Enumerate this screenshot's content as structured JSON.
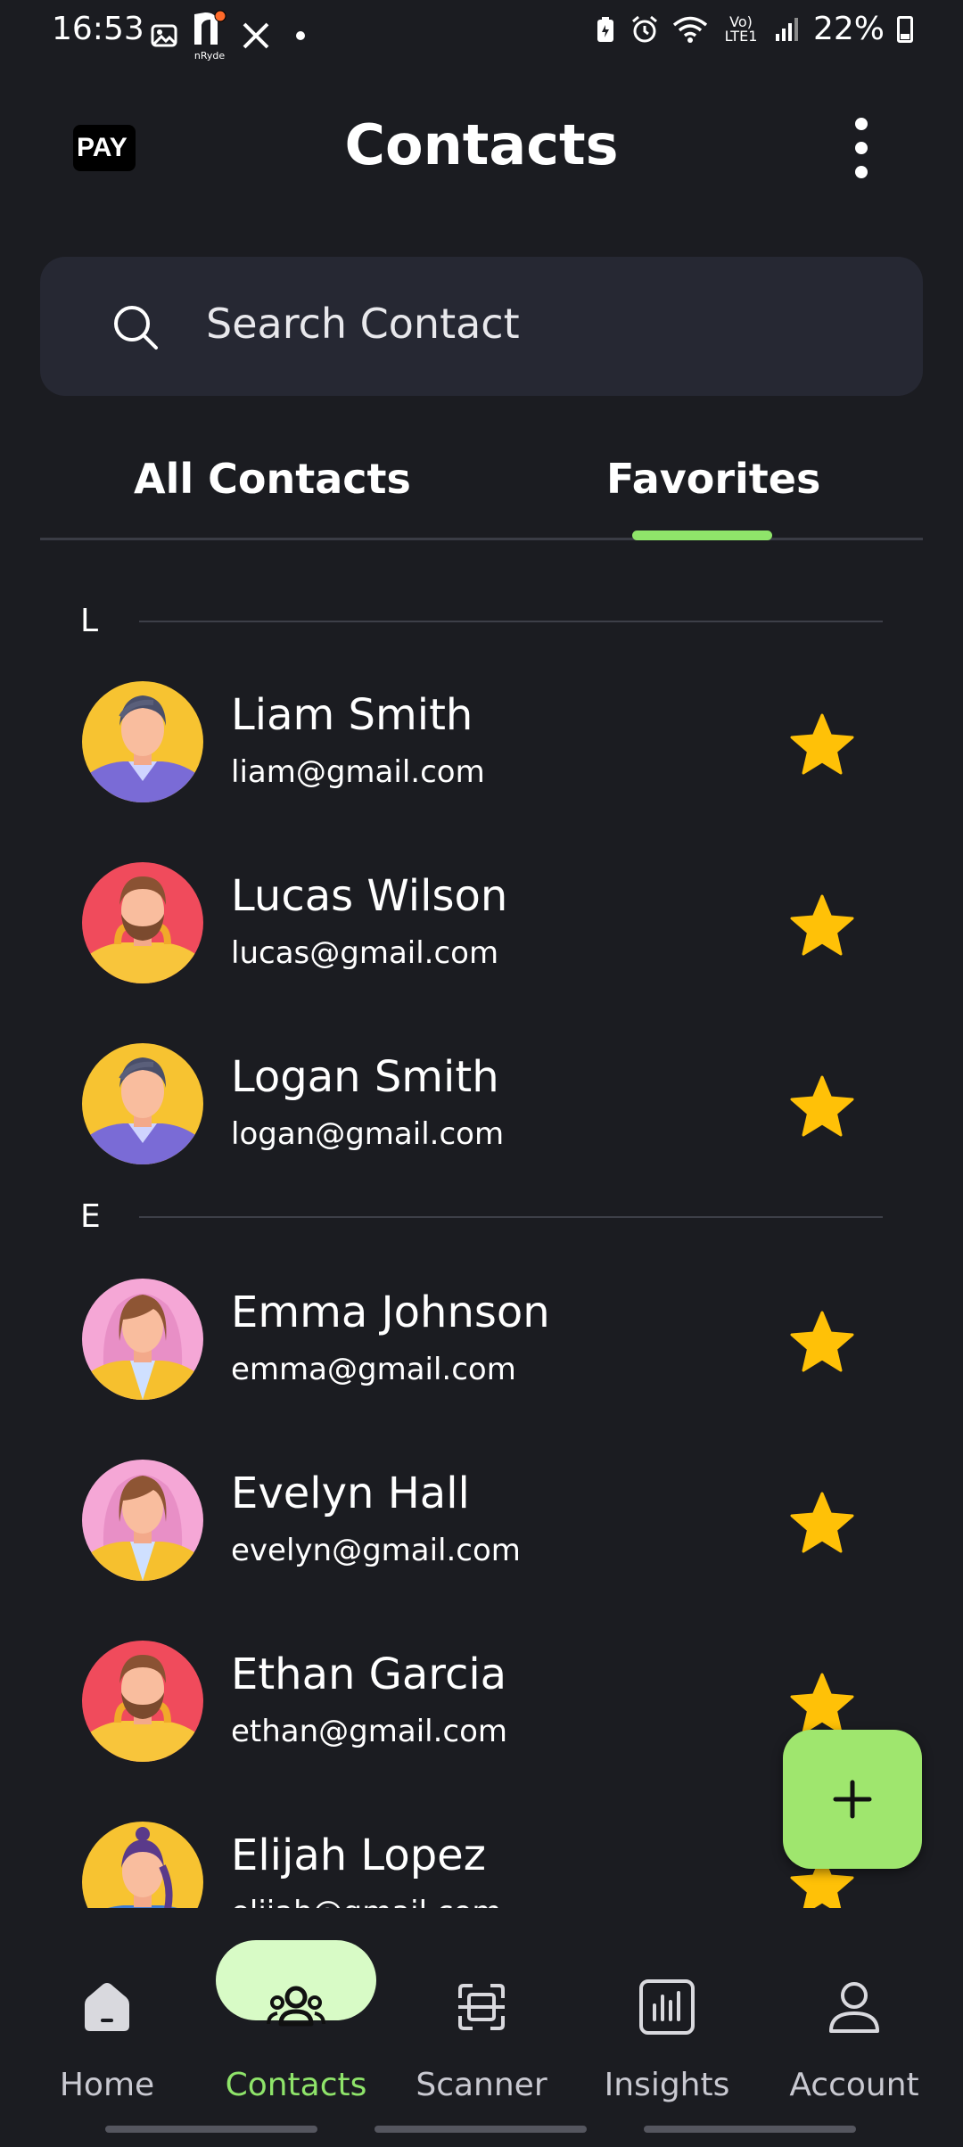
{
  "status_bar": {
    "time": "16:53",
    "battery": "22%",
    "network": "Vo) LTE1",
    "icons": [
      "gallery-icon",
      "nryde-icon",
      "x-icon",
      "dot-icon",
      "battery-saver-icon",
      "alarm-icon",
      "wifi-icon",
      "signal-icon",
      "battery-icon"
    ],
    "nryde_label": "nRyde"
  },
  "header": {
    "logo_text": "PAY",
    "title": "Contacts",
    "menu_icon": "more-vertical-icon"
  },
  "search": {
    "placeholder": "Search Contact",
    "icon": "search-icon"
  },
  "tabs": [
    {
      "label": "All Contacts",
      "active": false
    },
    {
      "label": "Favorites",
      "active": true
    }
  ],
  "colors": {
    "background": "#1b1c21",
    "surface": "#262833",
    "accent": "#8fe46a",
    "fab": "#9fe66e",
    "star": "#ffc107"
  },
  "sections": [
    {
      "letter": "L",
      "contacts": [
        {
          "name": "Liam Smith",
          "email": "liam@gmail.com",
          "favorite": true,
          "avatar": "male-avatar-icon"
        },
        {
          "name": "Lucas Wilson",
          "email": "lucas@gmail.com",
          "favorite": true,
          "avatar": "bearded-male-avatar-icon"
        },
        {
          "name": "Logan Smith",
          "email": "logan@gmail.com",
          "favorite": true,
          "avatar": "male-avatar-icon"
        }
      ]
    },
    {
      "letter": "E",
      "contacts": [
        {
          "name": "Emma Johnson",
          "email": "emma@gmail.com",
          "favorite": true,
          "avatar": "female-avatar-icon"
        },
        {
          "name": "Evelyn Hall",
          "email": "evelyn@gmail.com",
          "favorite": true,
          "avatar": "female-avatar-icon"
        },
        {
          "name": "Ethan Garcia",
          "email": "ethan@gmail.com",
          "favorite": true,
          "avatar": "bearded-male-avatar-icon"
        },
        {
          "name": "Elijah Lopez",
          "email": "elijah@gmail.com",
          "favorite": true,
          "avatar": "ponytail-avatar-icon"
        }
      ]
    }
  ],
  "fab": {
    "icon": "plus-icon"
  },
  "bottom_nav": [
    {
      "label": "Home",
      "icon": "home-icon",
      "active": false
    },
    {
      "label": "Contacts",
      "icon": "contacts-group-icon",
      "active": true
    },
    {
      "label": "Scanner",
      "icon": "scanner-icon",
      "active": false
    },
    {
      "label": "Insights",
      "icon": "insights-chart-icon",
      "active": false
    },
    {
      "label": "Account",
      "icon": "account-icon",
      "active": false
    }
  ]
}
